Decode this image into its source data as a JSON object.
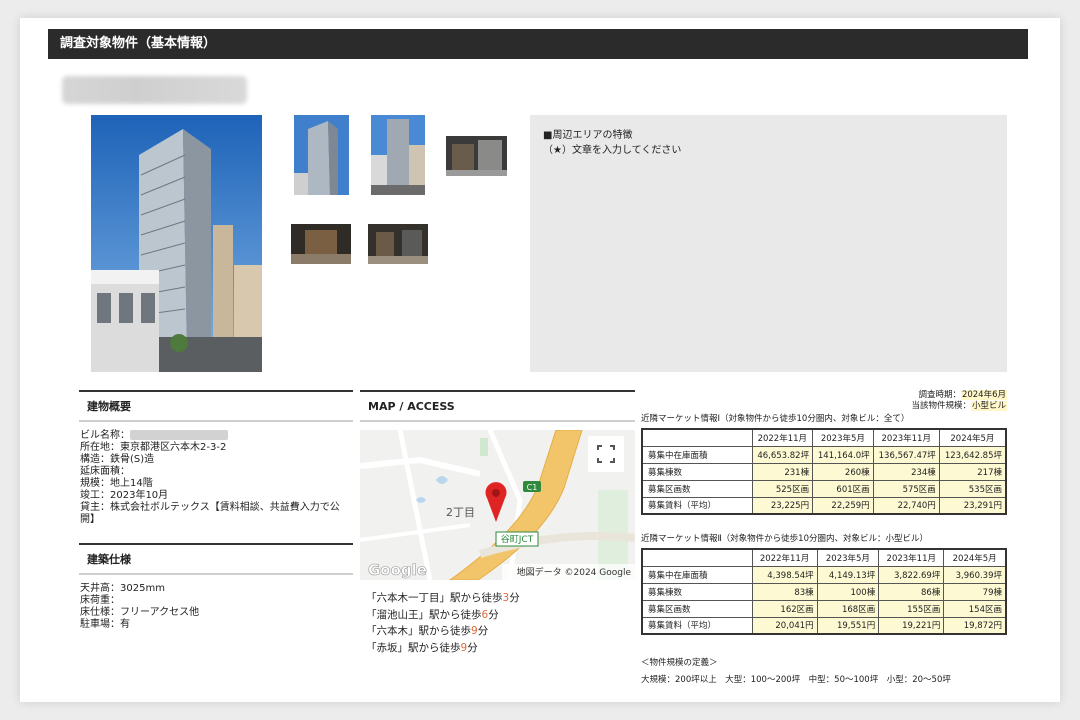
{
  "header": {
    "title": "調査対象物件（基本情報）"
  },
  "feature_area": {
    "heading": "■周辺エリアの特徴",
    "placeholder": "（★）文章を入力してください"
  },
  "building": {
    "title": "建物概要",
    "name_label": "ビル名称：",
    "rows": [
      "所在地：東京都港区六本木2-3-2",
      "構造：鉄骨(S)造",
      "延床面積：",
      "規模：地上14階",
      "竣工：2023年10月",
      "貸主：株式会社ボルテックス【賃料相談、共益費入力で公開】"
    ]
  },
  "spec": {
    "title": "建築仕様",
    "rows": [
      "天井高：3025mm",
      "床荷重：",
      "床仕様：フリーアクセス他",
      "駐車場：有"
    ]
  },
  "map": {
    "title": "MAP / ACCESS",
    "area_label": "2丁目",
    "route_label": "C1",
    "jct_label": "谷町JCT",
    "logo": "Google",
    "attribution": "地図データ ©2024 Google",
    "access": [
      {
        "pre": "「六本木一丁目」駅から徒歩",
        "min": "3",
        "post": "分"
      },
      {
        "pre": "「溜池山王」駅から徒歩",
        "min": "6",
        "post": "分"
      },
      {
        "pre": "「六本木」駅から徒歩",
        "min": "9",
        "post": "分"
      },
      {
        "pre": "「赤坂」駅から徒歩",
        "min": "9",
        "post": "分"
      }
    ]
  },
  "survey": {
    "period_label": "調査時期：",
    "period_value": "2024年6月",
    "scale_label": "当該物件規模：",
    "scale_value": "小型ビル"
  },
  "market1": {
    "caption": "近隣マーケット情報Ⅰ（対象物件から徒歩10分圏内、対象ビル：全て）",
    "headers": [
      "2022年11月",
      "2023年5月",
      "2023年11月",
      "2024年5月"
    ],
    "rows": [
      {
        "label": "募集中在庫面積",
        "values": [
          "46,653.82坪",
          "141,164.0坪",
          "136,567.47坪",
          "123,642.85坪"
        ]
      },
      {
        "label": "募集棟数",
        "values": [
          "231棟",
          "260棟",
          "234棟",
          "217棟"
        ]
      },
      {
        "label": "募集区画数",
        "values": [
          "525区画",
          "601区画",
          "575区画",
          "535区画"
        ]
      },
      {
        "label": "募集賃料（平均）",
        "values": [
          "23,225円",
          "22,259円",
          "22,740円",
          "23,291円"
        ]
      }
    ]
  },
  "market2": {
    "caption": "近隣マーケット情報Ⅱ（対象物件から徒歩10分圏内、対象ビル：小型ビル）",
    "headers": [
      "2022年11月",
      "2023年5月",
      "2023年11月",
      "2024年5月"
    ],
    "rows": [
      {
        "label": "募集中在庫面積",
        "values": [
          "4,398.54坪",
          "4,149.13坪",
          "3,822.69坪",
          "3,960.39坪"
        ]
      },
      {
        "label": "募集棟数",
        "values": [
          "83棟",
          "100棟",
          "86棟",
          "79棟"
        ]
      },
      {
        "label": "募集区画数",
        "values": [
          "162区画",
          "168区画",
          "155区画",
          "154区画"
        ]
      },
      {
        "label": "募集賃料（平均）",
        "values": [
          "20,041円",
          "19,551円",
          "19,221円",
          "19,872円"
        ]
      }
    ]
  },
  "definition": {
    "title": "＜物件規模の定義＞",
    "text": "大規模：200坪以上　大型：100〜200坪　中型：50〜100坪　小型：20〜50坪"
  },
  "icons": {
    "fullscreen": "fullscreen-icon",
    "pin": "map-pin-icon"
  },
  "colors": {
    "header_bg": "#2b2b2b",
    "highlight": "#fdf9d3",
    "walk_minutes": "#e06a3a",
    "pin": "#e02424",
    "expressway": "#f3c56a"
  }
}
